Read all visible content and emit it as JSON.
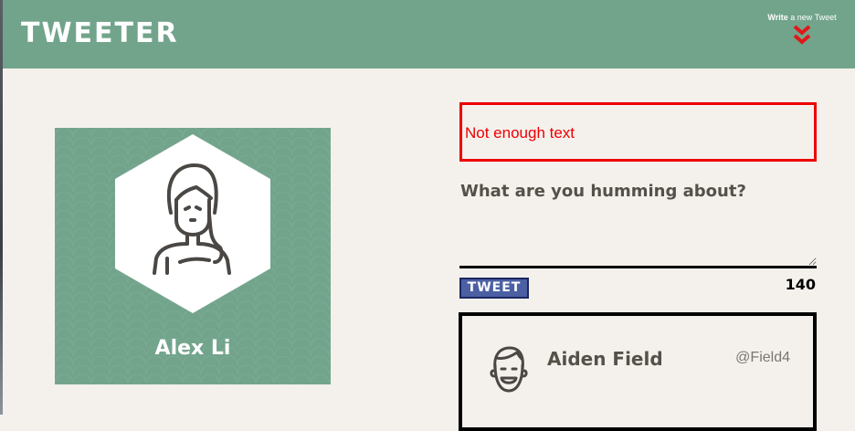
{
  "header": {
    "brand": "TWEETER",
    "compose_bold": "Write",
    "compose_rest": " a new Tweet",
    "chevron_icon": "double-chevron-down",
    "chevron_color": "#e01818"
  },
  "profile": {
    "name": "Alex Li",
    "avatar_icon": "person-long-hair",
    "card_color": "#72a48c"
  },
  "compose": {
    "error_message": "Not enough text",
    "prompt": "What are you humming about?",
    "textarea_value": "",
    "button_label": "TWEET",
    "char_counter": "140"
  },
  "feed": {
    "tweets": [
      {
        "author": "Aiden Field",
        "handle": "@Field4",
        "avatar_icon": "smiling-face"
      }
    ]
  },
  "colors": {
    "header_bg": "#72a48c",
    "page_bg": "#f4f1ed",
    "error": "#ee0000",
    "button_bg": "#4c5fa3"
  }
}
